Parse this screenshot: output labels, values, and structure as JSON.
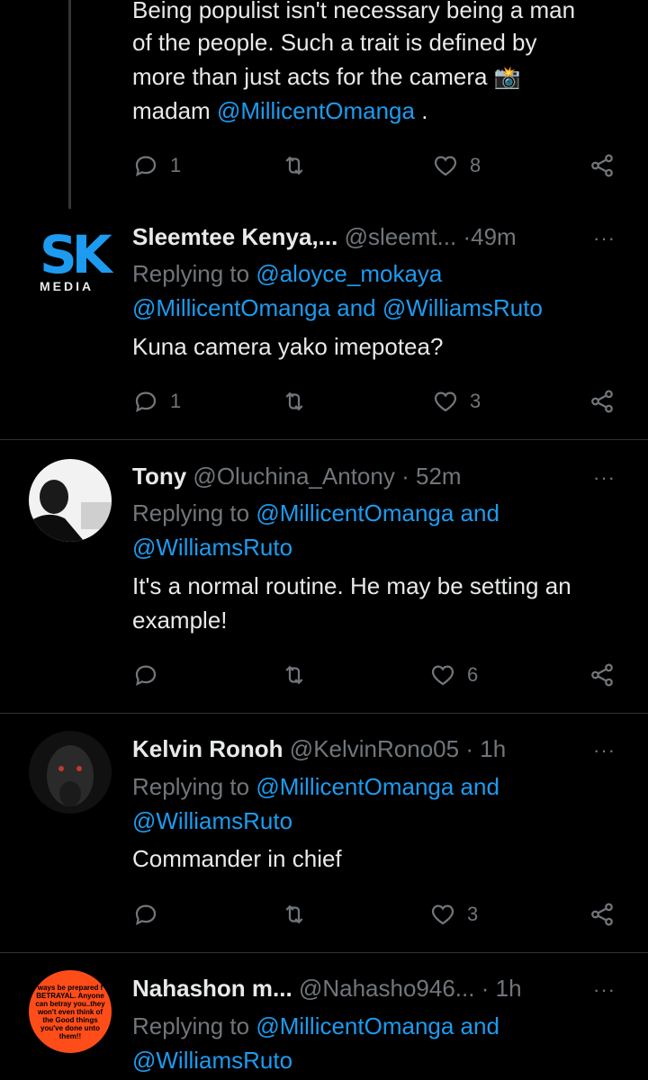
{
  "thread_top": {
    "lines": [
      "Being populist isn't necessary being a man",
      "of the people. Such a trait is defined by",
      "more than just acts for the camera"
    ],
    "emoji": "📸",
    "last_prefix": "madam",
    "last_mention": "@MillicentOmanga",
    "last_suffix": ".",
    "reply_count": "1",
    "like_count": "8"
  },
  "tweets": [
    {
      "name": "Sleemtee Kenya,...",
      "handle": "@sleemt...",
      "sep": "·",
      "time": "49m",
      "replying_prefix": "Replying to",
      "replying_line1_mentions": "@aloyce_mokaya",
      "replying_line2": "@MillicentOmanga and @WilliamsRuto",
      "text": [
        "Kuna camera yako imepotea?"
      ],
      "reply_count": "1",
      "like_count": "3",
      "avatar_letters": "SK",
      "avatar_label": "MEDIA"
    },
    {
      "name": "Tony",
      "handle": "@Oluchina_Antony",
      "sep": "·",
      "time": "52m",
      "replying_prefix": "Replying to",
      "replying_line1_mentions": "@MillicentOmanga and",
      "replying_line2": "@WilliamsRuto",
      "text": [
        "It's a normal routine. He may be setting an",
        "example!"
      ],
      "reply_count": "",
      "like_count": "6"
    },
    {
      "name": "Kelvin Ronoh",
      "handle": "@KelvinRono05",
      "sep": "·",
      "time": "1h",
      "replying_prefix": "Replying to",
      "replying_line1_mentions": "@MillicentOmanga and",
      "replying_line2": "@WilliamsRuto",
      "text": [
        "Commander in chief"
      ],
      "reply_count": "",
      "like_count": "3"
    },
    {
      "name": "Nahashon m...",
      "handle": "@Nahasho946...",
      "sep": "·",
      "time": "1h",
      "replying_prefix": "Replying to",
      "replying_line1_mentions": "@MillicentOmanga and",
      "replying_line2": "@WilliamsRuto",
      "avatar_text": "ways be prepared f BETRAYAL. Anyone can betray you..they won't even think of the Good things you've done unto them!!"
    }
  ],
  "more_icon": "···",
  "colors": {
    "accent": "#1d9bf0",
    "muted": "#71767b",
    "text": "#e7e9ea",
    "background": "#000000",
    "avatar_orange": "#ff4d1a"
  }
}
